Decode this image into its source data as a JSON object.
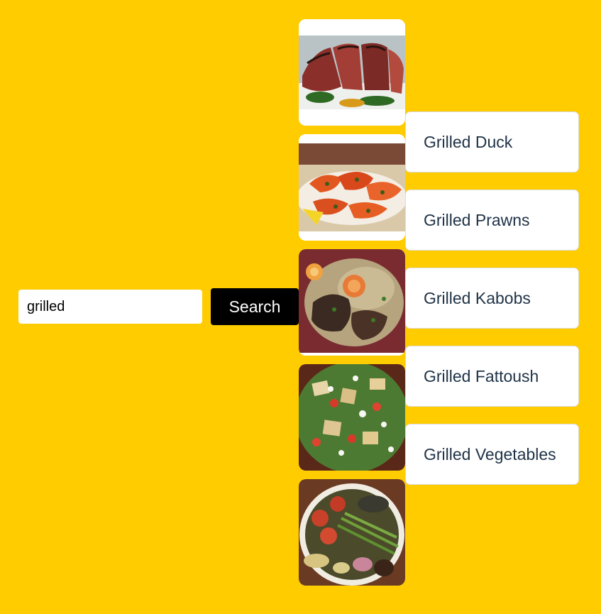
{
  "search": {
    "value": "grilled",
    "button_label": "Search"
  },
  "results": [
    {
      "name": "Grilled Duck"
    },
    {
      "name": "Grilled Prawns"
    },
    {
      "name": "Grilled Kabobs"
    },
    {
      "name": "Grilled Fattoush"
    },
    {
      "name": "Grilled Vegetables"
    }
  ],
  "colors": {
    "background": "#FFCC00",
    "button": "#000000",
    "card": "#ffffff",
    "result_text": "#1f3347"
  }
}
